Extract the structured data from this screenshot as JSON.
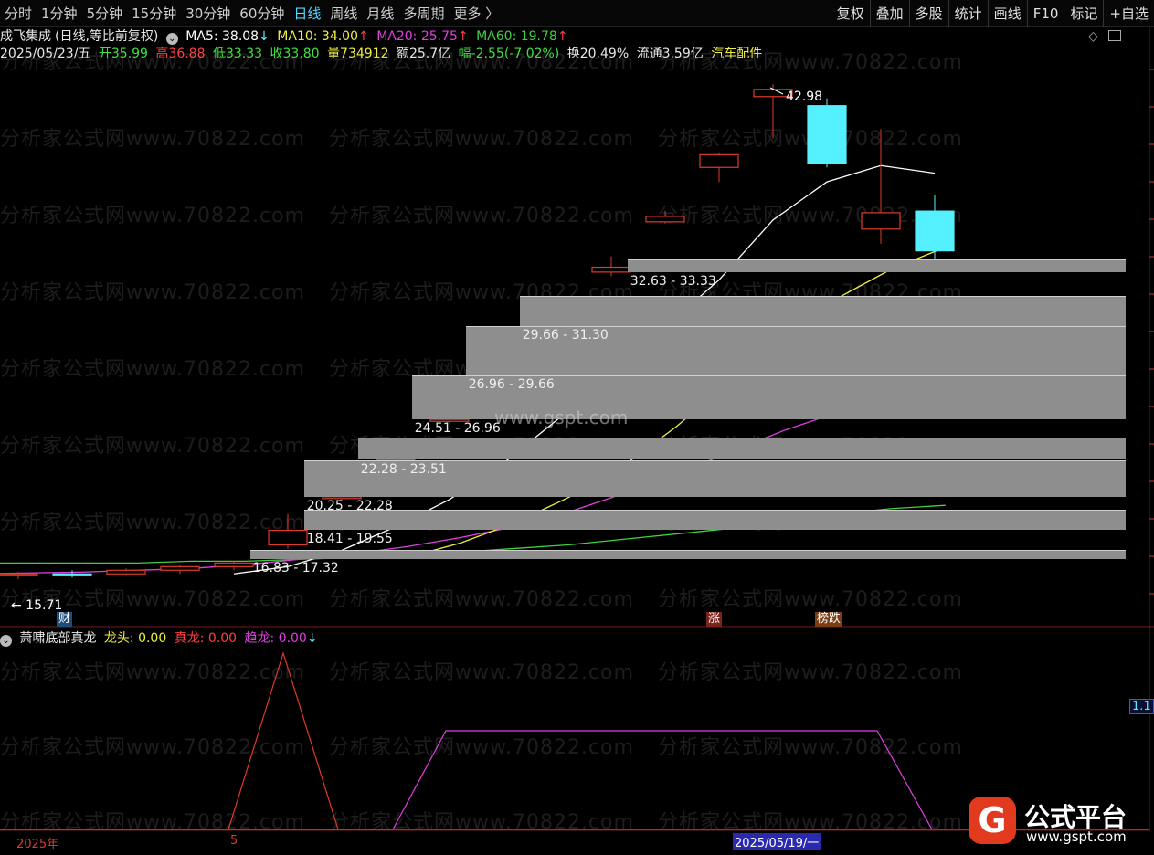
{
  "toolbar": {
    "tabs": [
      "分时",
      "1分钟",
      "5分钟",
      "15分钟",
      "30分钟",
      "60分钟",
      "日线",
      "周线",
      "月线",
      "多周期",
      "更多 〉"
    ],
    "active_tab": "日线",
    "right_buttons": [
      "复权",
      "叠加",
      "多股",
      "统计",
      "画线",
      "F10",
      "标记",
      "+自选"
    ]
  },
  "stock": {
    "name": "成飞集成",
    "mode": "(日线,等比前复权)",
    "ma5": "MA5: 38.08",
    "ma5_arrow": "↓",
    "ma10": "MA10: 34.00",
    "ma10_arrow": "↑",
    "ma20": "MA20: 25.75",
    "ma20_arrow": "↑",
    "ma60": "MA60: 19.78",
    "ma60_arrow": "↑",
    "date": "2025/05/23/五",
    "open": "开35.99",
    "high": "高36.88",
    "low": "低33.33",
    "close": "收33.80",
    "volume": "量734912",
    "amount": "额25.7亿",
    "change": "幅-2.55(-7.02%)",
    "turnover": "换20.49%",
    "float": "流通3.59亿",
    "sector": "汽车配件"
  },
  "colors": {
    "ma5": "#ffffff",
    "ma10": "#f0f040",
    "ma20": "#e040e0",
    "ma60": "#40d040",
    "up": "#e03a2a",
    "down": "#55f0ff",
    "zone": "#8e8e8e"
  },
  "chart_data": {
    "type": "candlestick",
    "price_range": [
      14,
      44
    ],
    "annotations": {
      "high_label": "42.98",
      "low_label": "← 15.71"
    },
    "candles": [
      {
        "o": 15.9,
        "h": 16.1,
        "l": 15.71,
        "c": 16.0,
        "up": true
      },
      {
        "o": 16.0,
        "h": 16.2,
        "l": 15.8,
        "c": 15.95,
        "up": false
      },
      {
        "o": 16.0,
        "h": 16.3,
        "l": 15.9,
        "c": 16.2,
        "up": true
      },
      {
        "o": 16.2,
        "h": 16.5,
        "l": 16.0,
        "c": 16.4,
        "up": true
      },
      {
        "o": 16.4,
        "h": 16.7,
        "l": 16.2,
        "c": 16.6,
        "up": true
      },
      {
        "o": 17.6,
        "h": 19.3,
        "l": 17.4,
        "c": 18.4,
        "up": true
      },
      {
        "o": 20.25,
        "h": 21.0,
        "l": 20.0,
        "c": 20.25,
        "up": true
      },
      {
        "o": 22.28,
        "h": 22.5,
        "l": 22.2,
        "c": 22.28,
        "up": true
      },
      {
        "o": 24.51,
        "h": 24.8,
        "l": 24.3,
        "c": 24.51,
        "up": true
      },
      {
        "o": 26.96,
        "h": 27.2,
        "l": 26.9,
        "c": 26.96,
        "up": true
      },
      {
        "o": 29.66,
        "h": 29.7,
        "l": 29.6,
        "c": 29.66,
        "up": true
      },
      {
        "o": 32.63,
        "h": 33.5,
        "l": 32.4,
        "c": 32.9,
        "up": true
      },
      {
        "o": 35.4,
        "h": 36.0,
        "l": 35.3,
        "c": 35.7,
        "up": true
      },
      {
        "o": 38.4,
        "h": 39.2,
        "l": 37.6,
        "c": 39.1,
        "up": true
      },
      {
        "o": 42.3,
        "h": 42.98,
        "l": 40.0,
        "c": 42.7,
        "up": true
      },
      {
        "o": 41.8,
        "h": 42.2,
        "l": 38.4,
        "c": 38.6,
        "up": false
      },
      {
        "o": 35.0,
        "h": 40.5,
        "l": 34.2,
        "c": 35.9,
        "up": true
      },
      {
        "o": 35.99,
        "h": 36.88,
        "l": 33.33,
        "c": 33.8,
        "up": false
      }
    ],
    "ma": {
      "ma5": [
        null,
        null,
        null,
        null,
        16.0,
        16.4,
        17.3,
        18.6,
        20.1,
        22.1,
        24.5,
        27.0,
        29.6,
        32.2,
        35.5,
        37.6,
        38.5,
        38.08
      ],
      "ma10": [
        null,
        null,
        null,
        null,
        null,
        null,
        null,
        null,
        null,
        16.9,
        17.7,
        18.8,
        20.2,
        21.9,
        24.1,
        26.6,
        28.9,
        31.2,
        32.8,
        34.0
      ],
      "ma20": [
        16.0,
        16.0,
        16.05,
        16.1,
        16.2,
        16.3,
        16.5,
        16.8,
        17.1,
        17.5,
        18.0,
        18.6,
        19.4,
        20.4,
        21.5,
        22.7,
        23.9,
        24.9,
        25.4,
        25.75
      ],
      "ma60": [
        16.6,
        16.6,
        16.6,
        16.6,
        16.6,
        16.7,
        16.7,
        16.8,
        16.9,
        17.0,
        17.2,
        17.4,
        17.6,
        17.9,
        18.2,
        18.5,
        18.9,
        19.3,
        19.6,
        19.78
      ]
    },
    "zones": [
      {
        "label": "16.83 - 17.32",
        "from": 16.83,
        "to": 17.32
      },
      {
        "label": "18.41 - 19.55",
        "from": 18.41,
        "to": 19.55
      },
      {
        "label": "20.25 - 22.28",
        "from": 20.25,
        "to": 22.28
      },
      {
        "label": "22.28 - 23.51",
        "from": 22.28,
        "to": 23.51
      },
      {
        "label": "24.51 - 26.96",
        "from": 24.51,
        "to": 26.96
      },
      {
        "label": "26.96 - 29.66",
        "from": 26.96,
        "to": 29.66
      },
      {
        "label": "29.66 - 31.30",
        "from": 29.66,
        "to": 31.3
      },
      {
        "label": "32.63 - 33.33",
        "from": 32.63,
        "to": 33.33
      }
    ],
    "badges": [
      {
        "text": "财",
        "color": "#3b82c4"
      },
      {
        "text": "涨",
        "color": "#c43a2a"
      },
      {
        "text": "榜跌",
        "color": "#c46a2a"
      }
    ]
  },
  "indicator": {
    "name": "萧啸底部真龙",
    "longtou": "龙头: 0.00",
    "zhenlong": "真龙: 0.00",
    "qulong": "趋龙: 0.00",
    "arrow": "↓",
    "right_value": "1.1",
    "red_peak": 1.0,
    "magenta_plateau": 0.6
  },
  "axis_dates": {
    "year": "2025年",
    "month": "5",
    "cursor_date": "2025/05/19/一"
  },
  "watermarks": {
    "main": "分析家公式网www.70822.com",
    "center": "www.gspt.com"
  },
  "logo": {
    "glyph": "G",
    "name": "公式平台",
    "site": "www.gspt.com"
  }
}
